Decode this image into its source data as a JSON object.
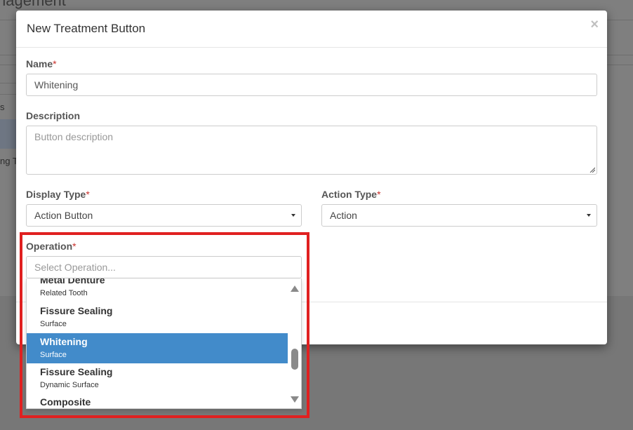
{
  "background": {
    "title_fragment": "nagement",
    "left_fragment_1": "s",
    "left_fragment_2": "ng T"
  },
  "modal": {
    "title": "New Treatment Button",
    "close_label": "×",
    "required_marker": "*",
    "name": {
      "label": "Name",
      "value": "Whitening"
    },
    "description": {
      "label": "Description",
      "placeholder": "Button description"
    },
    "display_type": {
      "label": "Display Type",
      "value": "Action Button"
    },
    "action_type": {
      "label": "Action Type",
      "value": "Action"
    },
    "operation": {
      "label": "Operation",
      "placeholder": "Select Operation...",
      "options": [
        {
          "title": "Metal Denture",
          "subtitle": "Related Tooth"
        },
        {
          "title": "Fissure Sealing",
          "subtitle": "Surface"
        },
        {
          "title": "Whitening",
          "subtitle": "Surface",
          "selected": true
        },
        {
          "title": "Fissure Sealing",
          "subtitle": "Dynamic Surface"
        },
        {
          "title": "Composite",
          "subtitle": ""
        }
      ]
    }
  },
  "colors": {
    "selected_option": "#428bca",
    "highlight_border": "#e02020",
    "required": "#c9302c"
  },
  "icons": [
    "close-icon",
    "caret-down-icon",
    "resize-handle-icon",
    "scroll-up-arrow-icon",
    "scroll-down-arrow-icon"
  ]
}
